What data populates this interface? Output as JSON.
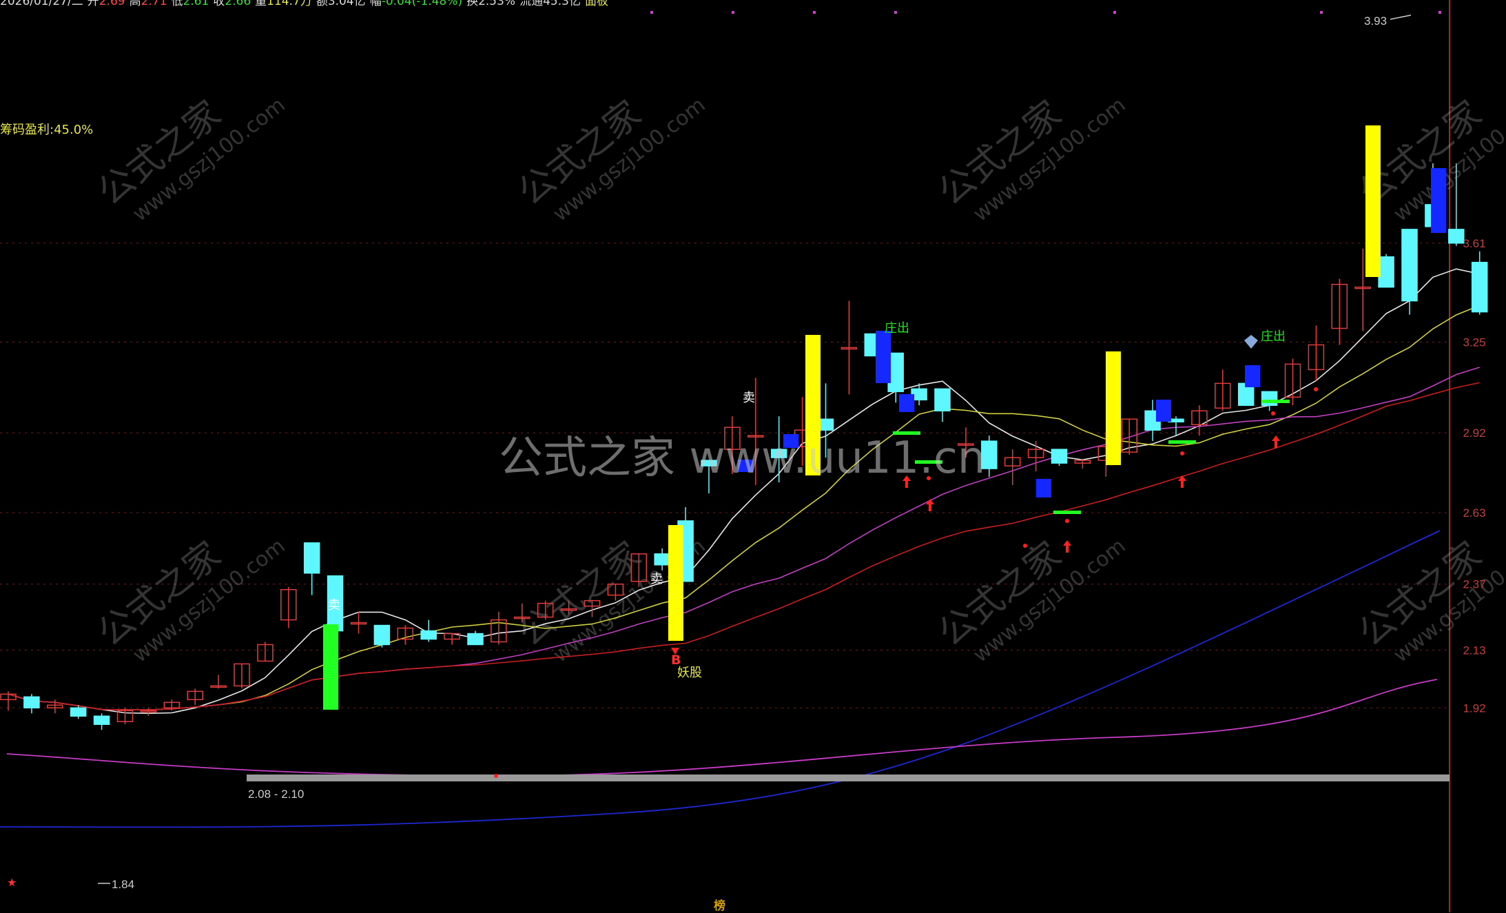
{
  "header": {
    "date": "2026/01/27/二",
    "open_label": "开",
    "open": "2.69",
    "high_label": "高",
    "high": "2.71",
    "low_label": "低",
    "low": "2.61",
    "close_label": "收",
    "close": "2.66",
    "volume_label": "量",
    "volume": "114.7万",
    "amount_label": "额",
    "amount": "3.04亿",
    "change_label": "幅",
    "change": "-0.04(-1.48%)",
    "turnover_label": "换",
    "turnover": "2.53%",
    "float_label": "流通",
    "float": "45.3亿",
    "board": "面板"
  },
  "indicator": {
    "chip_profit_label": "筹码盈利",
    "chip_profit_value": ":45.0%"
  },
  "watermark": {
    "center": "公式之家 www.uu11.cn",
    "tile_cn": "公式之家",
    "tile_url": "www.gszj100.com"
  },
  "annotations": {
    "high_mark": "3.93",
    "low_mark": "1.84",
    "range_label": "2.08 - 2.10",
    "sell": "卖",
    "buy": "B",
    "demon_stock": "妖股",
    "dealer_out": "庄出"
  },
  "status_tab": "榜",
  "colors": {
    "up_candle": "#e03c3c",
    "down_candle": "#5ff7ff",
    "bg": "#000000",
    "ma5": "#e8e8e8",
    "ma10": "#d0d040",
    "ma20": "#c040c0",
    "ma30": "#c81e1e",
    "ma60": "#1e28d2",
    "ma120": "#c83cc8",
    "signal_yellow": "#ffff00",
    "signal_green": "#22ff22",
    "signal_blue": "#1428ff",
    "price_axis": "#c83c3c"
  },
  "chart_data": {
    "type": "candlestick",
    "y_ticks": [
      3.61,
      3.25,
      2.92,
      2.63,
      2.37,
      2.13,
      1.92
    ],
    "ylim": [
      1.84,
      3.93
    ],
    "candles": [
      {
        "o": 1.95,
        "h": 1.98,
        "l": 1.91,
        "c": 1.97
      },
      {
        "o": 1.96,
        "h": 1.97,
        "l": 1.9,
        "c": 1.92
      },
      {
        "o": 1.92,
        "h": 1.95,
        "l": 1.9,
        "c": 1.93
      },
      {
        "o": 1.92,
        "h": 1.93,
        "l": 1.88,
        "c": 1.89
      },
      {
        "o": 1.89,
        "h": 1.9,
        "l": 1.84,
        "c": 1.86
      },
      {
        "o": 1.87,
        "h": 1.92,
        "l": 1.86,
        "c": 1.91
      },
      {
        "o": 1.91,
        "h": 1.92,
        "l": 1.89,
        "c": 1.91
      },
      {
        "o": 1.92,
        "h": 1.95,
        "l": 1.91,
        "c": 1.94
      },
      {
        "o": 1.95,
        "h": 1.99,
        "l": 1.93,
        "c": 1.98
      },
      {
        "o": 2.0,
        "h": 2.04,
        "l": 1.99,
        "c": 2.0
      },
      {
        "o": 2.0,
        "h": 2.08,
        "l": 1.99,
        "c": 2.08
      },
      {
        "o": 2.09,
        "h": 2.16,
        "l": 2.09,
        "c": 2.15
      },
      {
        "o": 2.24,
        "h": 2.36,
        "l": 2.21,
        "c": 2.35
      },
      {
        "o": 2.52,
        "h": 2.52,
        "l": 2.33,
        "c": 2.41
      },
      {
        "o": 2.4,
        "h": 2.4,
        "l": 2.2,
        "c": 2.2
      },
      {
        "o": 2.23,
        "h": 2.27,
        "l": 2.19,
        "c": 2.23
      },
      {
        "o": 2.22,
        "h": 2.22,
        "l": 2.14,
        "c": 2.15
      },
      {
        "o": 2.17,
        "h": 2.22,
        "l": 2.15,
        "c": 2.21
      },
      {
        "o": 2.2,
        "h": 2.24,
        "l": 2.16,
        "c": 2.17
      },
      {
        "o": 2.17,
        "h": 2.19,
        "l": 2.15,
        "c": 2.19
      },
      {
        "o": 2.19,
        "h": 2.2,
        "l": 2.15,
        "c": 2.15
      },
      {
        "o": 2.16,
        "h": 2.27,
        "l": 2.15,
        "c": 2.24
      },
      {
        "o": 2.25,
        "h": 2.3,
        "l": 2.23,
        "c": 2.25
      },
      {
        "o": 2.25,
        "h": 2.31,
        "l": 2.24,
        "c": 2.3
      },
      {
        "o": 2.28,
        "h": 2.31,
        "l": 2.26,
        "c": 2.28
      },
      {
        "o": 2.29,
        "h": 2.31,
        "l": 2.25,
        "c": 2.31
      },
      {
        "o": 2.33,
        "h": 2.37,
        "l": 2.31,
        "c": 2.37
      },
      {
        "o": 2.38,
        "h": 2.48,
        "l": 2.36,
        "c": 2.48
      },
      {
        "o": 2.48,
        "h": 2.5,
        "l": 2.42,
        "c": 2.44
      },
      {
        "o": 2.6,
        "h": 2.65,
        "l": 2.38,
        "c": 2.38
      },
      {
        "o": 2.82,
        "h": 2.82,
        "l": 2.7,
        "c": 2.8
      },
      {
        "o": 2.86,
        "h": 2.98,
        "l": 2.77,
        "c": 2.94
      },
      {
        "o": 2.91,
        "h": 3.12,
        "l": 2.73,
        "c": 2.91
      },
      {
        "o": 2.86,
        "h": 2.98,
        "l": 2.74,
        "c": 2.83
      },
      {
        "o": 2.87,
        "h": 3.05,
        "l": 2.8,
        "c": 2.93
      },
      {
        "o": 2.97,
        "h": 3.1,
        "l": 2.83,
        "c": 2.93
      },
      {
        "o": 3.23,
        "h": 3.4,
        "l": 3.06,
        "c": 3.23
      },
      {
        "o": 3.28,
        "h": 3.25,
        "l": 3.21,
        "c": 3.2
      },
      {
        "o": 3.21,
        "h": 3.21,
        "l": 3.03,
        "c": 3.07
      },
      {
        "o": 3.08,
        "h": 3.1,
        "l": 3.02,
        "c": 3.04
      },
      {
        "o": 3.08,
        "h": 3.08,
        "l": 2.96,
        "c": 3.0
      },
      {
        "o": 2.88,
        "h": 2.94,
        "l": 2.83,
        "c": 2.88
      },
      {
        "o": 2.89,
        "h": 2.91,
        "l": 2.76,
        "c": 2.79
      },
      {
        "o": 2.8,
        "h": 2.86,
        "l": 2.73,
        "c": 2.83
      },
      {
        "o": 2.83,
        "h": 2.89,
        "l": 2.78,
        "c": 2.86
      },
      {
        "o": 2.86,
        "h": 2.86,
        "l": 2.8,
        "c": 2.81
      },
      {
        "o": 2.81,
        "h": 2.82,
        "l": 2.79,
        "c": 2.82
      },
      {
        "o": 2.82,
        "h": 2.92,
        "l": 2.76,
        "c": 2.87
      },
      {
        "o": 2.85,
        "h": 2.97,
        "l": 2.84,
        "c": 2.97
      },
      {
        "o": 3.0,
        "h": 3.04,
        "l": 2.89,
        "c": 2.93
      },
      {
        "o": 2.97,
        "h": 2.98,
        "l": 2.91,
        "c": 2.96
      },
      {
        "o": 2.95,
        "h": 3.02,
        "l": 2.91,
        "c": 3.0
      },
      {
        "o": 3.01,
        "h": 3.15,
        "l": 3.0,
        "c": 3.1
      },
      {
        "o": 3.1,
        "h": 3.1,
        "l": 3.02,
        "c": 3.02
      },
      {
        "o": 3.07,
        "h": 3.07,
        "l": 3.0,
        "c": 3.02
      },
      {
        "o": 3.05,
        "h": 3.19,
        "l": 3.02,
        "c": 3.17
      },
      {
        "o": 3.15,
        "h": 3.31,
        "l": 3.11,
        "c": 3.24
      },
      {
        "o": 3.3,
        "h": 3.48,
        "l": 3.24,
        "c": 3.46
      },
      {
        "o": 3.45,
        "h": 3.59,
        "l": 3.29,
        "c": 3.45
      },
      {
        "o": 3.56,
        "h": 3.57,
        "l": 3.46,
        "c": 3.45
      },
      {
        "o": 3.66,
        "h": 3.66,
        "l": 3.35,
        "c": 3.4
      },
      {
        "o": 3.75,
        "h": 3.9,
        "l": 3.67,
        "c": 3.67
      },
      {
        "o": 3.66,
        "h": 3.9,
        "l": 3.6,
        "c": 3.61
      },
      {
        "o": 3.54,
        "h": 3.58,
        "l": 3.35,
        "c": 3.36
      }
    ]
  }
}
